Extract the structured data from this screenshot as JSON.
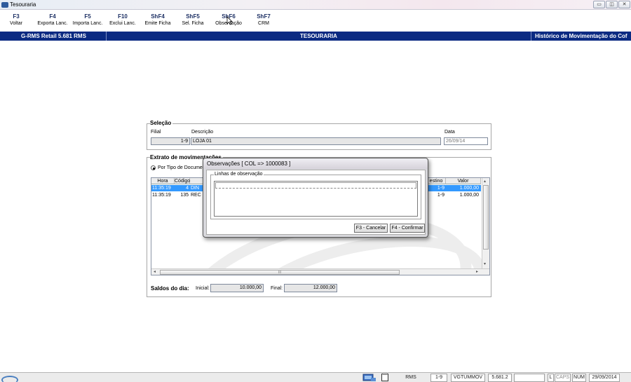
{
  "window": {
    "title": "Tesouraria",
    "min_btn": "▭",
    "max_btn": "◫",
    "close_btn": "✕"
  },
  "toolbar": [
    {
      "key": "F3",
      "label": "Voltar"
    },
    {
      "key": "F4",
      "label": "Exporta Lanc."
    },
    {
      "key": "F5",
      "label": "Importa Lanc."
    },
    {
      "key": "F10",
      "label": "Exclui Lanc."
    },
    {
      "key": "ShF4",
      "label": "Emite Ficha"
    },
    {
      "key": "ShF5",
      "label": "Sel. Ficha"
    },
    {
      "key": "ShF6",
      "label": "Observação"
    },
    {
      "key": "ShF7",
      "label": "CRM"
    }
  ],
  "header": {
    "left": "G-RMS Retail 5.681 RMS",
    "center": "TESOURARIA",
    "right": "Histórico de Movimentação do Cof"
  },
  "selecao": {
    "title": "Seleção",
    "filial_label": "Filial",
    "descricao_label": "Descrição",
    "data_label": "Data",
    "filial_value": "1-9",
    "descricao_value": "LOJA 01",
    "data_value": "26/09/14"
  },
  "extrato": {
    "title": "Extrato de movimentações",
    "radio_label": "Por Tipo de Documen",
    "columns": {
      "hora": "Hora",
      "codigo": "Código",
      "destino": "estino",
      "valor": "Valor"
    },
    "rows": [
      {
        "hora": "11:35:19",
        "codigo": "4",
        "desc": "DIN",
        "destino": "1-9",
        "valor": "1.000,00"
      },
      {
        "hora": "11:35:19",
        "codigo": "135",
        "desc": "REC",
        "destino": "1-9",
        "valor": "1.000,00"
      }
    ],
    "hscroll_grip": "III"
  },
  "saldos": {
    "title": "Saldos do dia:",
    "inicial_label": "Inicial:",
    "inicial_value": "10.000,00",
    "final_label": "Final:",
    "final_value": "12.000,00"
  },
  "dialog": {
    "title": "Observações [ COL => 1000083 ]",
    "group_label": "Linhas de observação",
    "input_value": "",
    "cancel_label": "F3 - Cancelar",
    "confirm_label": "F4 - Confirmar"
  },
  "statusbar": {
    "system": "RMS",
    "filial": "1-9",
    "user": "VGTUMMOV",
    "version": "5.681.2",
    "blank": "",
    "l": "L",
    "caps": "CAPS",
    "num": "NUM",
    "date": "29/09/2014"
  },
  "colors": {
    "header_bg": "#0b2a82",
    "selection": "#3399ff",
    "dialog_bg": "#d8d8dc"
  }
}
